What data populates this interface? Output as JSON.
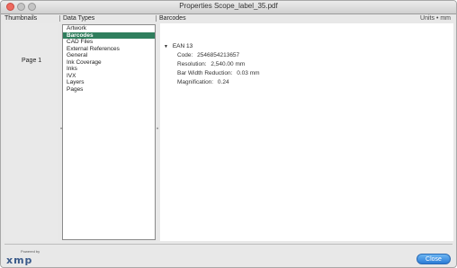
{
  "window": {
    "title": "Properties Scope_label_35.pdf"
  },
  "headers": {
    "thumbnails": "Thumbnails",
    "data_types": "Data Types",
    "barcodes": "Barcodes",
    "units": "Units • mm"
  },
  "thumbnails": {
    "page_label": "Page 1"
  },
  "data_types": [
    {
      "label": "Artwork",
      "selected": false
    },
    {
      "label": "Barcodes",
      "selected": true
    },
    {
      "label": "CAD Files",
      "selected": false
    },
    {
      "label": "External References",
      "selected": false
    },
    {
      "label": "General",
      "selected": false
    },
    {
      "label": "Ink Coverage",
      "selected": false
    },
    {
      "label": "Inks",
      "selected": false
    },
    {
      "label": "IVX",
      "selected": false
    },
    {
      "label": "Layers",
      "selected": false
    },
    {
      "label": "Pages",
      "selected": false
    }
  ],
  "barcode": {
    "name": "EAN 13",
    "fields": [
      {
        "key": "Code:",
        "value": "2546854213657"
      },
      {
        "key": "Resolution:",
        "value": "2,540.00 mm"
      },
      {
        "key": "Bar Width Reduction:",
        "value": "0.03 mm"
      },
      {
        "key": "Magnification:",
        "value": "0.24"
      }
    ]
  },
  "footer": {
    "logo_small": "Powered by",
    "logo": "xmp",
    "close_label": "Close"
  },
  "colors": {
    "selection": "#2f7e5d",
    "close_button": "#2b7bd6"
  }
}
